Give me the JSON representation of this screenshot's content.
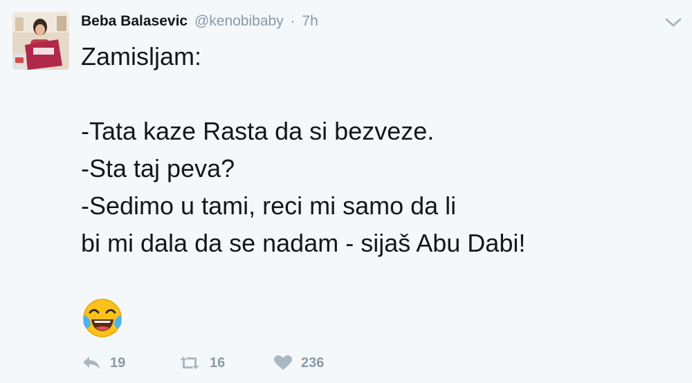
{
  "tweet": {
    "author_name": "Beba Balasevic",
    "author_handle": "@kenobibaby",
    "separator": "·",
    "time": "7h",
    "lines": [
      "Zamisljam:",
      "",
      "-Tata kaze Rasta da si bezveze.",
      "-Sta taj peva?",
      "-Sedimo u tami, reci mi samo da li",
      "bi mi dala da se nadam - sijaš Abu Dabi!",
      ""
    ],
    "emoji": "tears-of-joy-emoji"
  },
  "actions": {
    "reply_count": "19",
    "retweet_count": "16",
    "like_count": "236"
  },
  "icons": {
    "reply": "reply-icon",
    "retweet": "retweet-icon",
    "like": "heart-icon",
    "menu": "chevron-down-icon"
  },
  "colors": {
    "background": "#f5f8fa",
    "text": "#14171a",
    "muted": "#8899a6",
    "icon": "#aab8c2"
  }
}
